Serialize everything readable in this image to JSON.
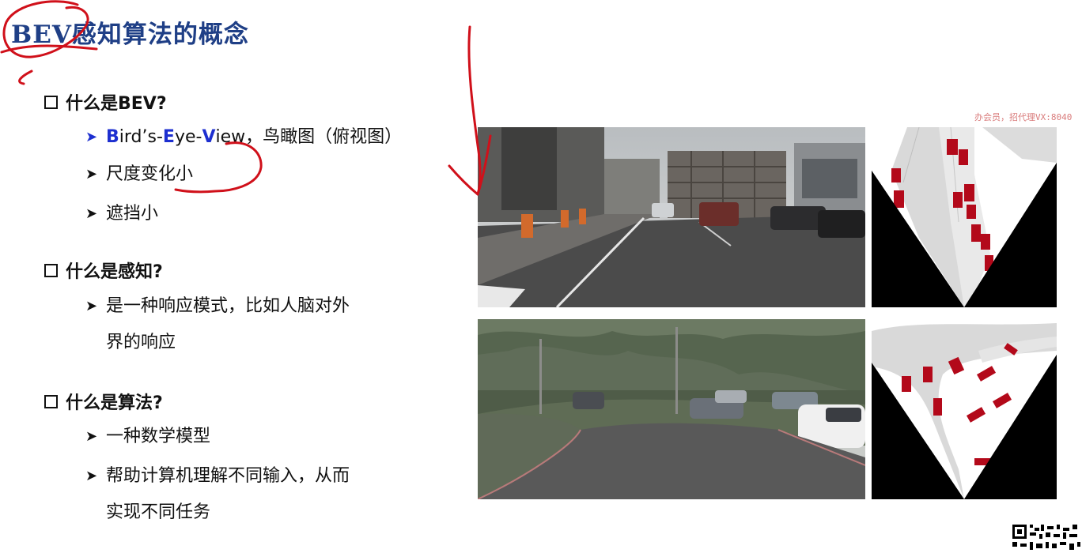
{
  "slide": {
    "title": "BEV感知算法的概念",
    "watermark": "办会员，招代理VX:8040"
  },
  "sections": [
    {
      "heading": "什么是BEV?",
      "items": [
        {
          "b1": "B",
          "t1": "ird’s-",
          "b2": "E",
          "t2": "ye-",
          "b3": "V",
          "t3": "iew，鸟瞰图（俯视图）"
        },
        {
          "text": "尺度变化小"
        },
        {
          "text": "遮挡小"
        }
      ]
    },
    {
      "heading": "什么是感知?",
      "items": [
        {
          "line1": "是一种响应模式，比如人脑对外",
          "line2": "界的响应"
        }
      ]
    },
    {
      "heading": "什么是算法?",
      "items": [
        {
          "text": "一种数学模型"
        },
        {
          "line1": "帮助计算机理解不同输入，从而",
          "line2": "实现不同任务"
        }
      ]
    }
  ],
  "colors": {
    "title": "#1f3f86",
    "accent_blue": "#1d2fd0",
    "annotation_red": "#d0101a",
    "bev_vehicle": "#b3091a"
  },
  "icons": [
    "square-bullet-icon",
    "chevron-right-icon",
    "qr-code-icon"
  ]
}
